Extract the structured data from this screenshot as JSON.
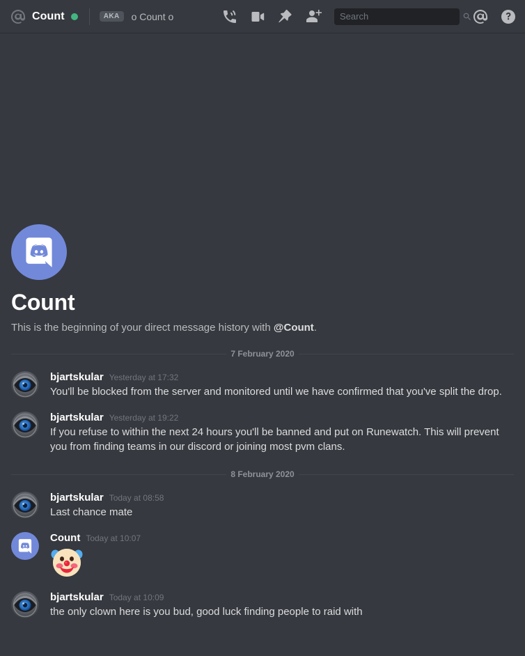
{
  "header": {
    "at_icon": "at-icon",
    "dm_name": "Count",
    "status": "online",
    "status_color": "#43b581",
    "aka_badge": "AKA",
    "aka_value": "o Count o",
    "icons": [
      "call-icon",
      "video-icon",
      "pin-icon",
      "add-friend-icon",
      "mention-icon",
      "help-icon"
    ],
    "search": {
      "placeholder": "Search",
      "value": "",
      "icon": "search-icon"
    }
  },
  "intro": {
    "avatar": "discord-clyde-logo",
    "title": "Count",
    "description_prefix": "This is the beginning of your direct message history with ",
    "description_mention": "@Count",
    "description_suffix": "."
  },
  "dividers": {
    "first": "7 February 2020",
    "second": "8 February 2020"
  },
  "messages": [
    {
      "author": "bjartskular",
      "avatar": "eye-emblem-avatar",
      "time": "Yesterday at 17:32",
      "text": "You'll be blocked from the server and monitored until we have confirmed that you've split the drop."
    },
    {
      "author": "bjartskular",
      "avatar": "eye-emblem-avatar",
      "time": "Yesterday at 19:22",
      "text": "If you refuse to within the next 24 hours you'll be banned and put on Runewatch. This will prevent you from finding teams in our discord or joining most pvm clans."
    },
    {
      "author": "bjartskular",
      "avatar": "eye-emblem-avatar",
      "time": "Today at 08:58",
      "text": "Last chance mate"
    },
    {
      "author": "Count",
      "avatar": "discord-clyde-logo",
      "time": "Today at 10:07",
      "text": "",
      "emoji": "clown-face-emoji"
    },
    {
      "author": "bjartskular",
      "avatar": "eye-emblem-avatar",
      "time": "Today at 10:09",
      "text": "the only clown here is you bud, good luck finding people to raid with"
    }
  ],
  "colors": {
    "background": "#36393f",
    "topbar": "#36393f",
    "search_background": "#202225",
    "accent_blurple": "#7289da",
    "online_green": "#43b581",
    "text_primary": "#dcddde",
    "text_muted": "#72767d"
  }
}
